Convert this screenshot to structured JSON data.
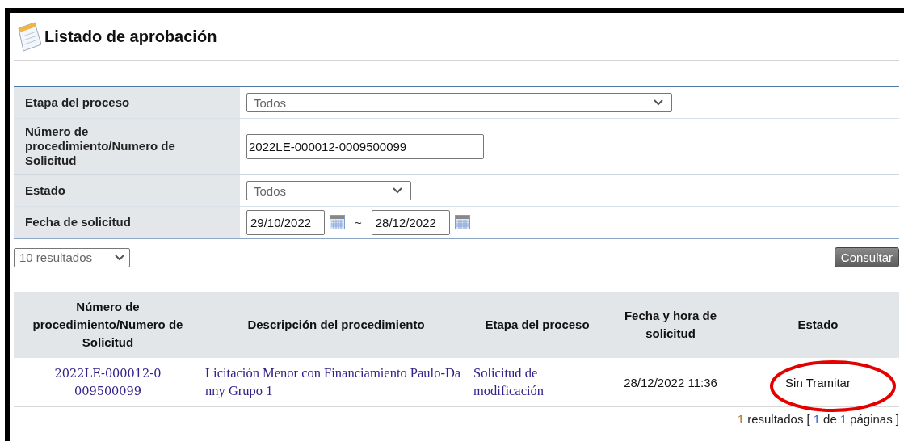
{
  "page": {
    "title": "Listado de aprobación"
  },
  "filters": [
    {
      "kind": "select",
      "label": "Etapa del proceso",
      "value": "Todos"
    },
    {
      "kind": "text",
      "label": "Número de procedimiento/Numero de Solicitud",
      "value": "2022LE-000012-0009500099"
    },
    {
      "kind": "select",
      "label": "Estado",
      "value": "Todos"
    },
    {
      "kind": "daterange",
      "label": "Fecha de solicitud",
      "from": "29/10/2022",
      "separator": "~",
      "to": "28/12/2022"
    }
  ],
  "page_size": {
    "value": "10 resultados"
  },
  "search_button": {
    "label": "Consultar"
  },
  "table": {
    "columns": [
      "Número de procedimiento/Numero de Solicitud",
      "Descripción del procedimiento",
      "Etapa del proceso",
      "Fecha y hora de solicitud",
      "Estado"
    ],
    "rows": [
      {
        "number": "2022LE-000012-0009500099",
        "description": "Licitación Menor con Financiamiento Paulo-Danny Grupo 1",
        "stage": "Solicitud de modificación",
        "datetime": "28/12/2022 11:36",
        "status": "Sin Tramitar",
        "highlighted": true
      }
    ]
  },
  "pager": {
    "count": "1",
    "count_label": "resultados [",
    "page": "1",
    "of": "de",
    "pages": "1",
    "pages_label": "páginas ]"
  }
}
